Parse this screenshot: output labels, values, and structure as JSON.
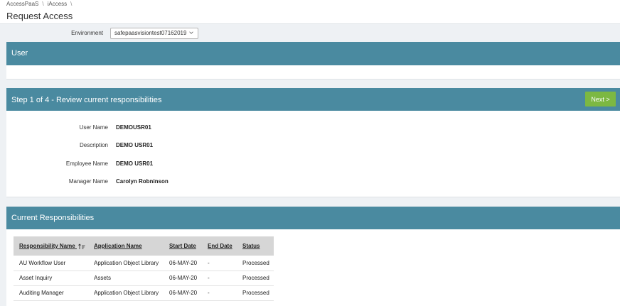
{
  "breadcrumb": [
    "AccessPaaS",
    "iAccess"
  ],
  "page_title": "Request Access",
  "environment": {
    "label": "Environment",
    "value": "safepaasvisiontest07162019"
  },
  "user_panel": {
    "title": "User"
  },
  "step_panel": {
    "title": "Step 1 of 4 - Review current responsibilities",
    "next_label": "Next >",
    "fields": [
      {
        "label": "User Name",
        "value": "DEMOUSR01"
      },
      {
        "label": "Description",
        "value": "DEMO USR01"
      },
      {
        "label": "Employee Name",
        "value": "DEMO USR01"
      },
      {
        "label": "Manager Name",
        "value": "Carolyn Robninson"
      }
    ]
  },
  "responsibilities_panel": {
    "title": "Current Responsibilities",
    "columns": [
      "Responsibility Name",
      "Application Name",
      "Start Date",
      "End Date",
      "Status"
    ],
    "rows": [
      [
        "AU Workflow User",
        "Application Object Library",
        "06-MAY-20",
        "-",
        "Processed"
      ],
      [
        "Asset Inquiry",
        "Assets",
        "06-MAY-20",
        "-",
        "Processed"
      ],
      [
        "Auditing Manager",
        "Application Object Library",
        "06-MAY-20",
        "-",
        "Processed"
      ]
    ]
  },
  "colors": {
    "panel_header": "#4a8aa0",
    "next_button": "#7cb842",
    "background": "#eef1f4"
  }
}
